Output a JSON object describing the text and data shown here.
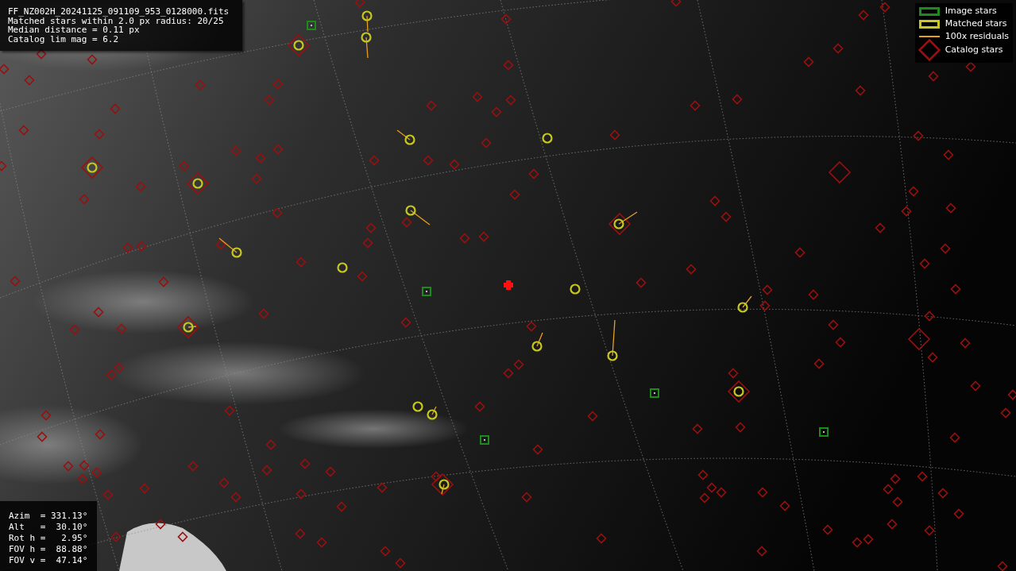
{
  "info_panel": {
    "lines": [
      "FF_NZ002H_20241125_091109_953_0128000.fits",
      "Matched stars within 2.0 px radius: 20/25",
      "Median distance = 0.11 px",
      "Catalog lim mag = 6.2"
    ]
  },
  "legend": {
    "items": [
      {
        "kind": "image",
        "label": "Image stars",
        "color": "#1c8a1c"
      },
      {
        "kind": "matched",
        "label": "Matched stars",
        "color": "#c8c81e"
      },
      {
        "kind": "residual",
        "label": "100x residuals",
        "color": "#e6a020"
      },
      {
        "kind": "catalog",
        "label": "Catalog stars",
        "color": "#9a1010"
      }
    ]
  },
  "pointing_panel": {
    "lines": [
      "Azim  = 331.13°",
      "Alt   =  30.10°",
      "Rot h =   2.95°",
      "FOV h =  88.88°",
      "FOV v =  47.14°"
    ]
  }
}
